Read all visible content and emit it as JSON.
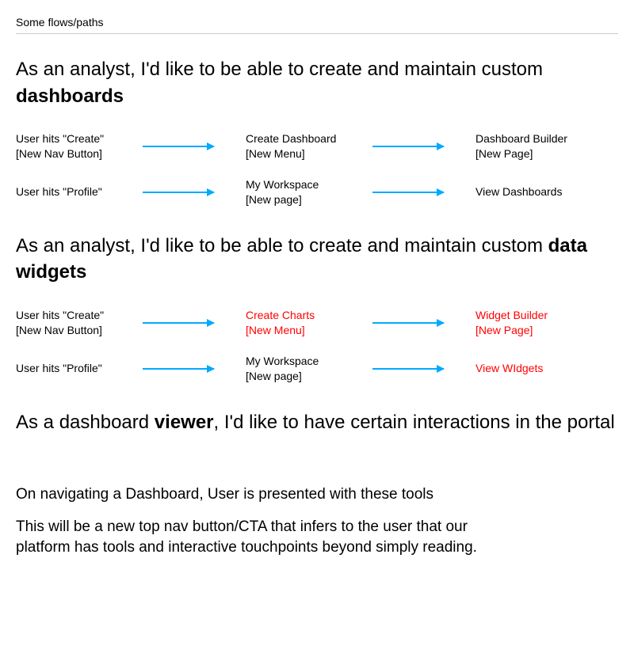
{
  "sectionHeader": "Some flows/paths",
  "heading1_pre": "As an analyst, I'd like to be able to create and maintain custom ",
  "heading1_bold": "dashboards",
  "flow1": {
    "row1": {
      "start_l1": "User hits \"Create\"",
      "start_l2": "[New Nav Button]",
      "mid_l1": "Create Dashboard",
      "mid_l2": "[New Menu]",
      "end_l1": "Dashboard Builder",
      "end_l2": "[New Page]"
    },
    "row2": {
      "start_l1": "User hits \"Profile\"",
      "mid_l1": "My Workspace",
      "mid_l2": "[New page]",
      "end_l1": "View Dashboards"
    }
  },
  "heading2_pre": "As an analyst, I'd like to be able to create and maintain custom ",
  "heading2_bold": "data widgets",
  "flow2": {
    "row1": {
      "start_l1": "User hits \"Create\"",
      "start_l2": "[New Nav Button]",
      "mid_l1": "Create Charts",
      "mid_l2": "[New Menu]",
      "end_l1": "Widget Builder",
      "end_l2": "[New Page]"
    },
    "row2": {
      "start_l1": "User hits \"Profile\"",
      "mid_l1": "My Workspace",
      "mid_l2": "[New page]",
      "end_l1": "View WIdgets"
    }
  },
  "heading3_pre": "As a dashboard ",
  "heading3_bold": "viewer",
  "heading3_post": ", I'd like to have certain interactions in the portal",
  "body1": "On navigating a Dashboard, User is presented with these tools",
  "body2": "This will be a new top nav button/CTA that infers to the user that our platform has tools and interactive touchpoints beyond simply reading."
}
